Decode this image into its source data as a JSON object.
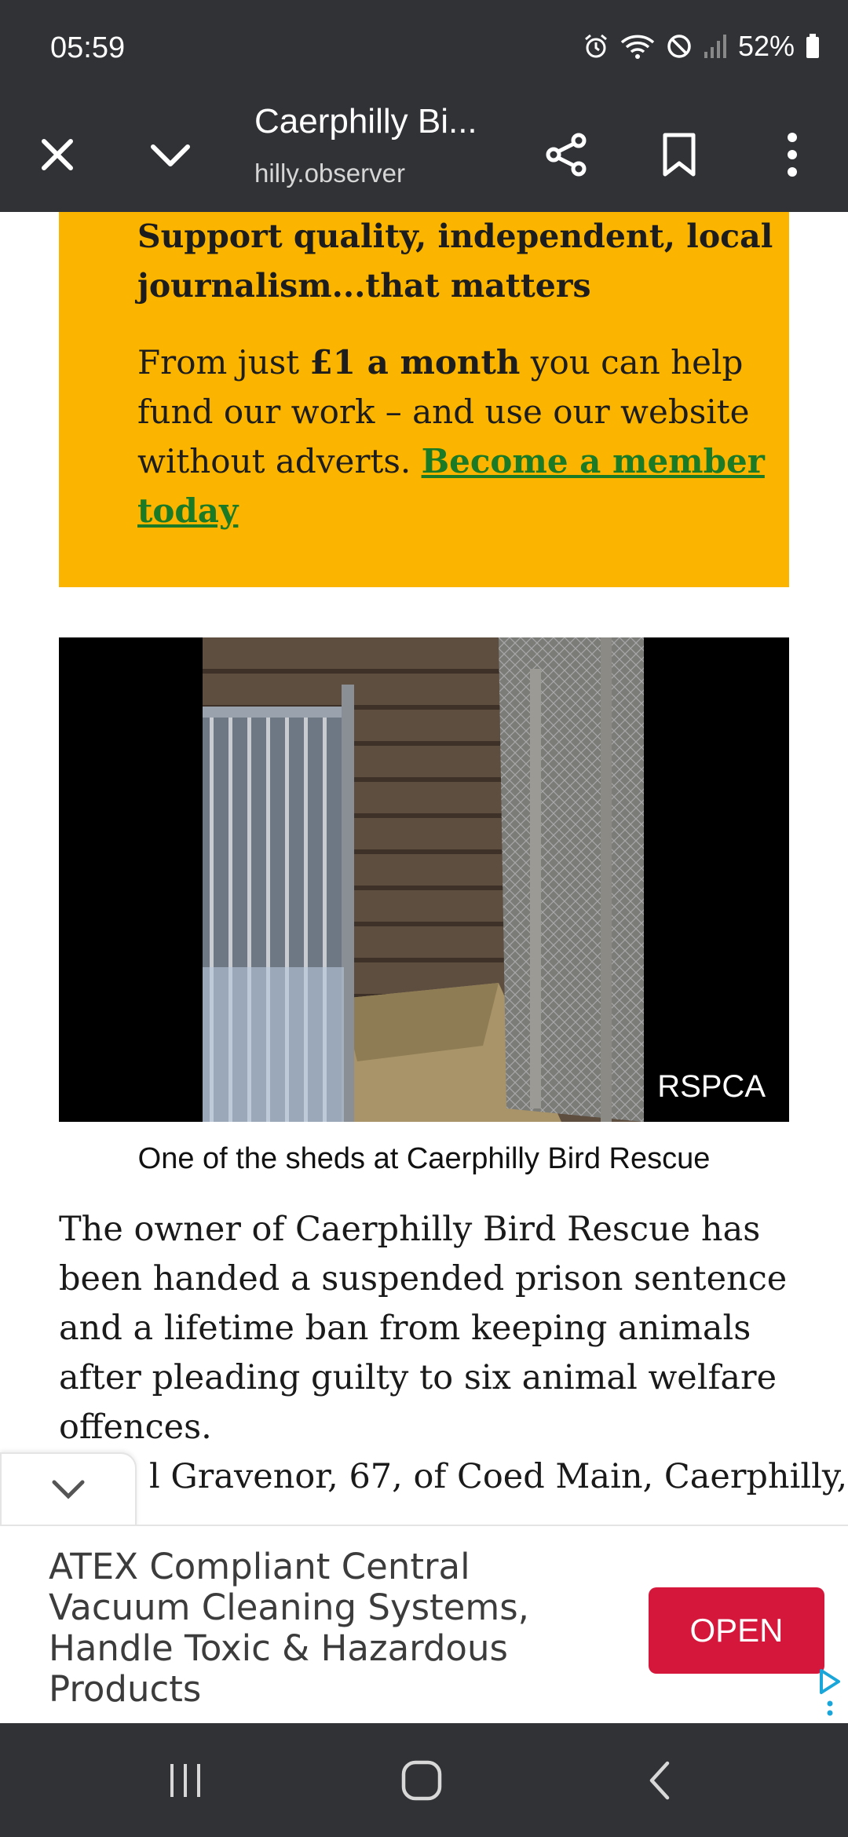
{
  "status_bar": {
    "time": "05:59",
    "battery": "52%"
  },
  "browser": {
    "page_title": "Caerphilly Bi...",
    "url": "hilly.observer"
  },
  "support_box": {
    "heading": "Support quality, independent, local journalism...that matters",
    "text_prefix": "From just ",
    "price": "£1 a month",
    "text_middle": " you can help fund our work – and use our website without adverts. ",
    "link": "Become a member today"
  },
  "photo": {
    "credit": "RSPCA",
    "caption": "One of the sheds at Caerphilly Bird Rescue"
  },
  "article": {
    "paragraph_1": "The owner of Caerphilly Bird Rescue has been handed a suspended prison sentence and a lifetime ban from keeping animals after pleading guilty to six animal welfare offences.",
    "paragraph_2_partial": "l Gravenor, 67, of Coed Main, Caerphilly,"
  },
  "ad": {
    "text": "ATEX Compliant Central Vacuum Cleaning Systems, Handle Toxic & Hazardous Products",
    "button": "OPEN"
  },
  "colors": {
    "support_bg": "#fbb400",
    "link_green": "#1b7a25",
    "ad_button": "#d4173b",
    "chrome": "#303236"
  }
}
